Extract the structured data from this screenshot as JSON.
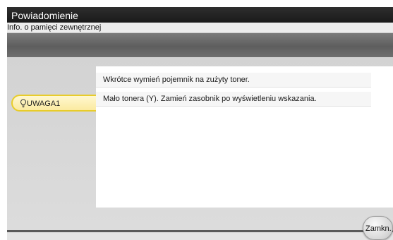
{
  "window": {
    "title": "Powiadomienie",
    "subtitle": "Info. o pamięci zewnętrznej"
  },
  "warning_tab": {
    "label": "UWAGA1",
    "icon": "toner-warning-icon",
    "color": "#e8cc2a"
  },
  "messages": [
    "Wkrótce wymień pojemnik na zużyty toner.",
    "Mało tonera (Y). Zamień zasobnik po wyświetleniu wskazania."
  ],
  "buttons": {
    "close_label": "Zamkn."
  }
}
